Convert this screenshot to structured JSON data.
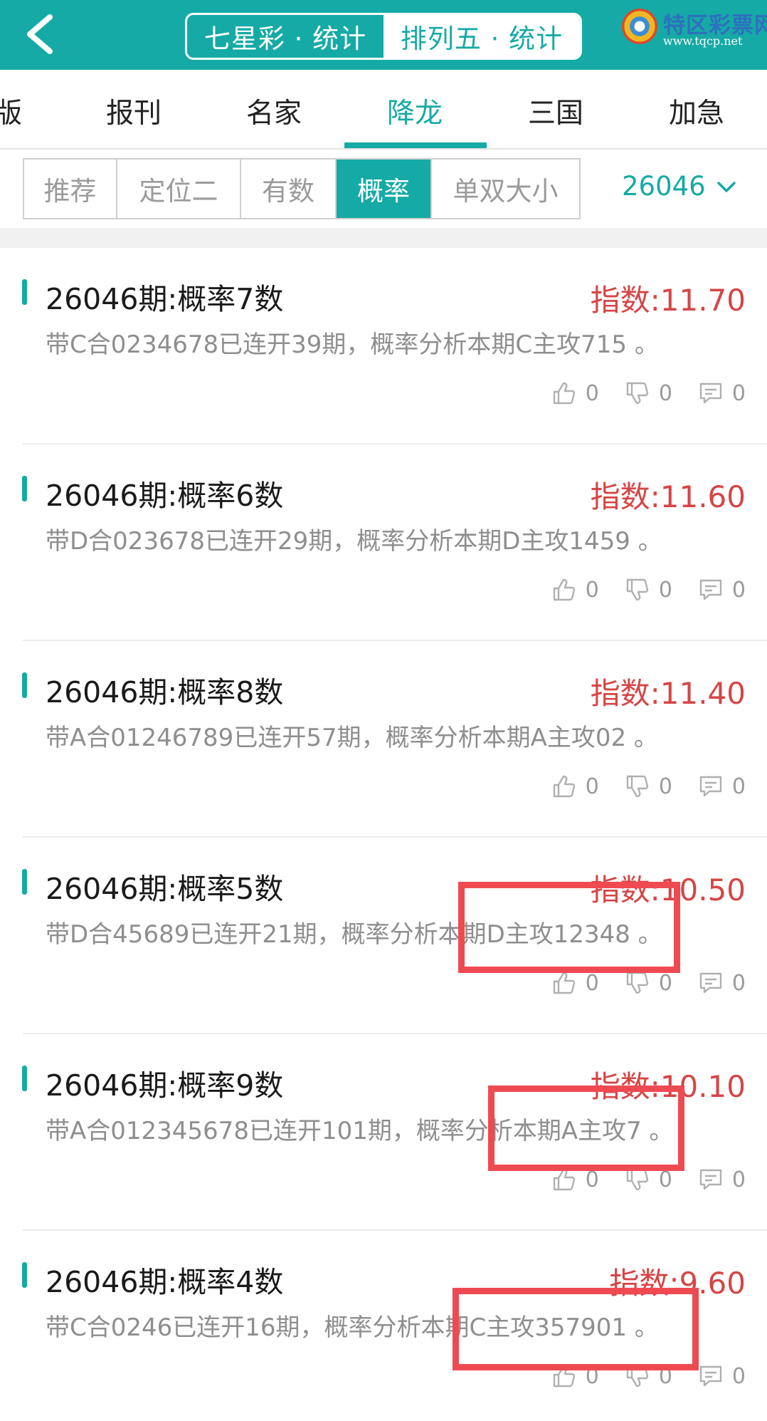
{
  "header": {
    "segments": [
      "七星彩 · 统计",
      "排列五 · 统计"
    ],
    "logo_title": "特区彩票网",
    "logo_url": "www.tqcp.net"
  },
  "categories": [
    "版",
    "报刊",
    "名家",
    "降龙",
    "三国",
    "加急"
  ],
  "active_category": "降龙",
  "subtabs": [
    "推荐",
    "定位二",
    "有数",
    "概率",
    "单双大小"
  ],
  "active_subtab": "概率",
  "period": "26046",
  "items": [
    {
      "title": "26046期:概率7数",
      "index": "指数:11.70",
      "desc": "带C合0234678已连开39期，概率分析本期C主攻715 。",
      "likes": "0",
      "dislikes": "0",
      "comments": "0"
    },
    {
      "title": "26046期:概率6数",
      "index": "指数:11.60",
      "desc": "带D合023678已连开29期，概率分析本期D主攻1459 。",
      "likes": "0",
      "dislikes": "0",
      "comments": "0"
    },
    {
      "title": "26046期:概率8数",
      "index": "指数:11.40",
      "desc": "带A合01246789已连开57期，概率分析本期A主攻02 。",
      "likes": "0",
      "dislikes": "0",
      "comments": "0"
    },
    {
      "title": "26046期:概率5数",
      "index": "指数:10.50",
      "desc": "带D合45689已连开21期，概率分析本期D主攻12348 。",
      "likes": "0",
      "dislikes": "0",
      "comments": "0"
    },
    {
      "title": "26046期:概率9数",
      "index": "指数:10.10",
      "desc": "带A合012345678已连开101期，概率分析本期A主攻7 。",
      "likes": "0",
      "dislikes": "0",
      "comments": "0"
    },
    {
      "title": "26046期:概率4数",
      "index": "指数:9.60",
      "desc": "带C合0246已连开16期，概率分析本期C主攻357901 。",
      "likes": "0",
      "dislikes": "0",
      "comments": "0"
    }
  ],
  "colors": {
    "accent": "#15aaa5",
    "index_red": "#d64545",
    "highlight": "#ef4a52"
  }
}
